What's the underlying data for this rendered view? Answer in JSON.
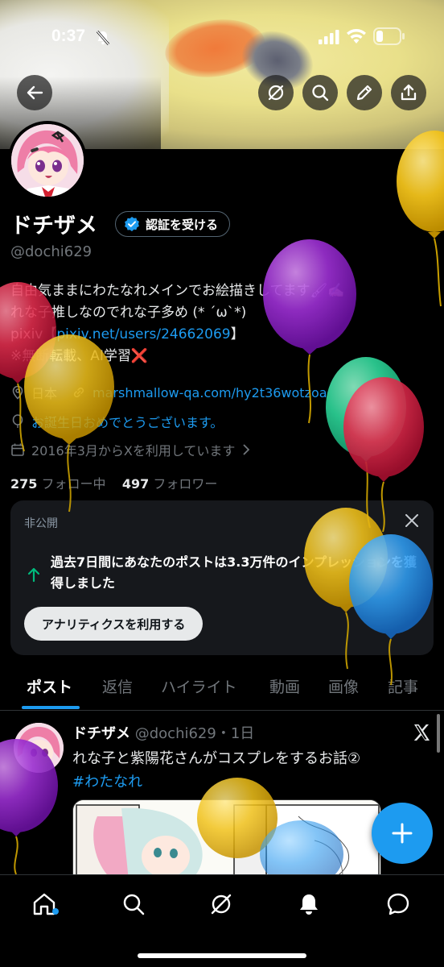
{
  "status": {
    "time": "0:37"
  },
  "header": {
    "back": "back-arrow-icon",
    "actions": [
      "grok-icon",
      "search-icon",
      "edit-icon",
      "share-icon"
    ]
  },
  "profile": {
    "name": "ドチザメ",
    "verify_button": "認証を受ける",
    "handle": "@dochi629",
    "bio_line1": "自由気ままにわたなれメインでお絵描きしてます🖌✍🏻",
    "bio_line2": "れな子推しなのでれな子多め (* ´ω`*)",
    "bio_line3_prefix": "pixiv【",
    "bio_line3_link": "pixiv.net/users/24662069",
    "bio_line3_suffix": "】",
    "bio_line4": "※無断転載、AI学習❌",
    "location": "日本",
    "website": "marshmallow-qa.com/hy2t36wotzoa",
    "birthday": "お誕生日おめでとうございます。",
    "joined": "2016年3月からXを利用しています",
    "following_count": "275",
    "following_label": "フォロー中",
    "followers_count": "497",
    "followers_label": "フォロワー"
  },
  "private_card": {
    "label": "非公開",
    "message": "過去7日間にあなたのポストは3.3万件のインプレッションを獲得しました",
    "button": "アナリティクスを利用する"
  },
  "tabs": [
    "ポスト",
    "返信",
    "ハイライト",
    "動画",
    "画像",
    "記事"
  ],
  "post": {
    "name": "ドチザメ",
    "meta": "@dochi629・1日",
    "text": "れな子と紫陽花さんがコスプレをするお話②",
    "hashtag": "#わたなれ"
  },
  "bottom_nav": [
    "home-icon",
    "search-icon",
    "grok-icon",
    "notifications-icon",
    "messages-icon"
  ],
  "colors": {
    "accent": "#1d9bf0",
    "background": "#000000",
    "card": "#16181c"
  }
}
